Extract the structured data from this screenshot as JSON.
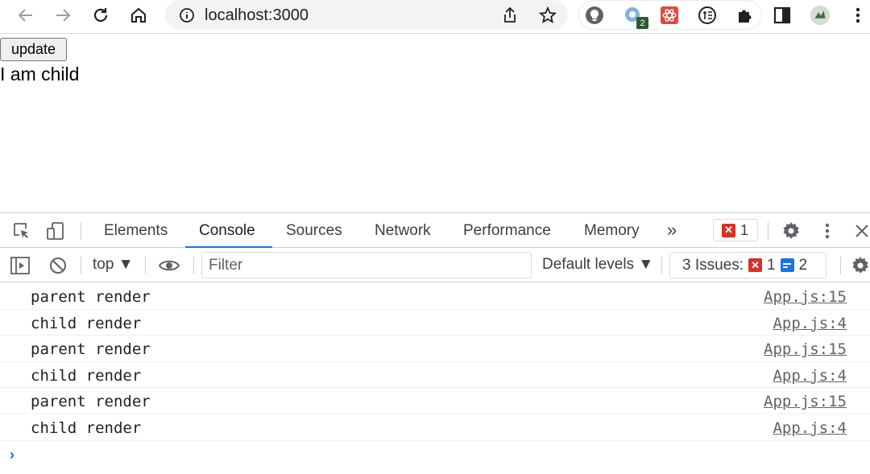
{
  "browser": {
    "url": "localhost:3000",
    "extension_badge": "2"
  },
  "page": {
    "button_label": "update",
    "text": "I am child"
  },
  "devtools": {
    "tabs": [
      "Elements",
      "Console",
      "Sources",
      "Network",
      "Performance",
      "Memory"
    ],
    "active_tab": "Console",
    "more_tabs": "»",
    "error_count": "1",
    "context": "top ▼",
    "filter_placeholder": "Filter",
    "levels": "Default levels ▼",
    "issues_label": "3 Issues:",
    "issues_errors": "1",
    "issues_info": "2",
    "log": [
      {
        "message": "parent render",
        "source": "App.js:15"
      },
      {
        "message": "child render",
        "source": "App.js:4"
      },
      {
        "message": "parent render",
        "source": "App.js:15"
      },
      {
        "message": "child render",
        "source": "App.js:4"
      },
      {
        "message": "parent render",
        "source": "App.js:15"
      },
      {
        "message": "child render",
        "source": "App.js:4"
      }
    ],
    "prompt": "›"
  },
  "colors": {
    "accent": "#1a73e8",
    "error": "#d93025"
  }
}
